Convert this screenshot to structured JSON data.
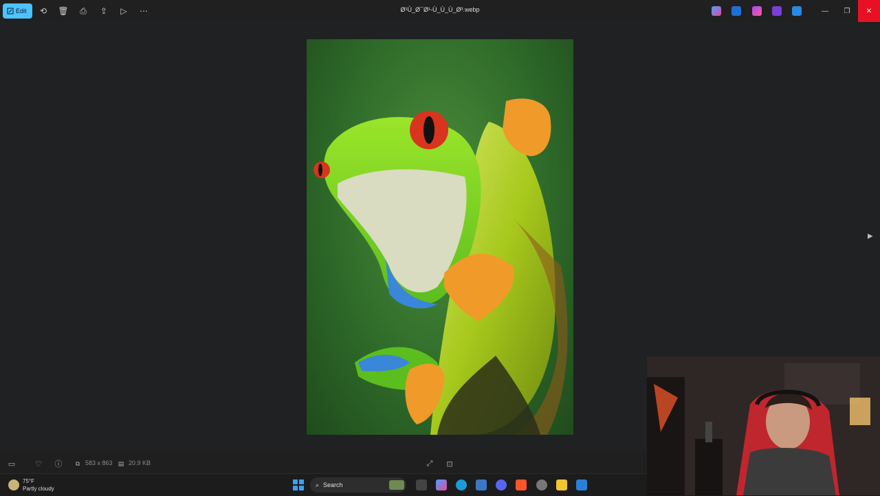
{
  "toolbar": {
    "edit_label": "Edit",
    "icons": [
      "rotate-icon",
      "delete-icon",
      "print-icon",
      "share-icon",
      "slideshow-icon",
      "more-icon"
    ]
  },
  "window": {
    "title": "Ø¹Ù_Ø¯Ø¹-Ù_Ù_Ù_Ø³.webp",
    "controls": [
      "minimize",
      "restore",
      "close"
    ]
  },
  "bottom_bar": {
    "dimensions": "583 x 863",
    "file_size": "20.9 KB"
  },
  "taskbar": {
    "weather_temp": "75°F",
    "weather_desc": "Partly cloudy",
    "search_placeholder": "Search"
  },
  "colors": {
    "accent": "#4cc2ff",
    "close": "#e81123",
    "background": "#202020"
  }
}
